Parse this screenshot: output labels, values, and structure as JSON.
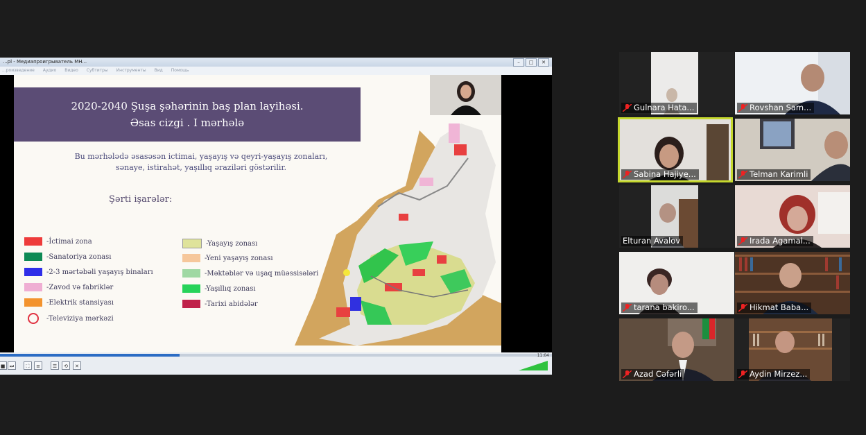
{
  "player": {
    "title": "...pl - Медиапроигрыватель MH...",
    "menu": [
      "...роизведение",
      "Аудио",
      "Видео",
      "Субтитры",
      "Инструменты",
      "Вид",
      "Помощь"
    ],
    "time": "11:04",
    "progress": 0.325,
    "volume": "100%"
  },
  "slide": {
    "title_line1": "2020-2040 Şuşa şəhərinin baş plan layihəsi.",
    "title_line2": "Əsas cizgi . I mərhələ",
    "subtitle_line1": "Bu mərhələdə əsasəsən ictimai, yaşayış və qeyri-yaşayış zonaları,",
    "subtitle_line2": "sənaye, istirahət, yaşıllıq əraziləri göstərilir.",
    "legend_title": "Şərti işarələr:",
    "legend_left": [
      {
        "label": "-İctimai zona",
        "color": "#ee3b3b"
      },
      {
        "label": "-Sanatoriya zonası",
        "color": "#0e8a55"
      },
      {
        "label": "-2-3 mərtəbəli yaşayış binaları",
        "color": "#2f2ee8"
      },
      {
        "label": "-Zavod və fabriklər",
        "color": "#efaed3"
      },
      {
        "label": "-Elektrik stansiyası",
        "color": "#f3932e"
      },
      {
        "label": "-Televiziya mərkəzi",
        "color": "circle"
      }
    ],
    "legend_right": [
      {
        "label": "-Yaşayış zonası",
        "color": "#dfe39b"
      },
      {
        "label": "-Yeni yaşayış zonası",
        "color": "#f6c79b"
      },
      {
        "label": "-Məktəblər və uşaq müəssisələri",
        "color": "#9fd8a3"
      },
      {
        "label": "-Yaşıllıq zonası",
        "color": "#27d35a"
      },
      {
        "label": "-Tarixi abidələr",
        "color": "#c0224a"
      }
    ]
  },
  "participants": [
    {
      "name": "Gulnara Hata...",
      "muted": true
    },
    {
      "name": "Rovshan Sam...",
      "muted": true
    },
    {
      "name": "Sabina Hajiye...",
      "muted": true,
      "active": true
    },
    {
      "name": "Telman Karimli",
      "muted": true
    },
    {
      "name": "Elturan Avalov",
      "muted": false
    },
    {
      "name": "Irada Agamal...",
      "muted": true
    },
    {
      "name": "tarana bakiro...",
      "muted": true
    },
    {
      "name": "Hikmat Baba...",
      "muted": true
    },
    {
      "name": "Azad Cəfərli",
      "muted": true
    },
    {
      "name": "Aydin Mirzez...",
      "muted": true
    }
  ]
}
